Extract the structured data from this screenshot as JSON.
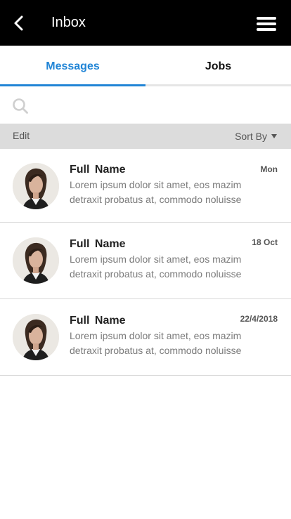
{
  "header": {
    "title": "Inbox"
  },
  "tabs": [
    {
      "label": "Messages",
      "active": true
    },
    {
      "label": "Jobs",
      "active": false
    }
  ],
  "search": {
    "placeholder": "",
    "value": ""
  },
  "toolbar": {
    "edit_label": "Edit",
    "sort_label": "Sort By"
  },
  "messages": [
    {
      "name": "Full Name",
      "date": "Mon",
      "preview": "Lorem ipsum dolor sit amet, eos mazim detraxit probatus at, commodo noluisse"
    },
    {
      "name": "Full Name",
      "date": "18 Oct",
      "preview": "Lorem ipsum dolor sit amet, eos mazim detraxit probatus at, commodo noluisse"
    },
    {
      "name": "Full Name",
      "date": "22/4/2018",
      "preview": "Lorem ipsum dolor sit amet, eos mazim detraxit probatus at, commodo noluisse"
    }
  ],
  "colors": {
    "accent": "#2185d6",
    "header_bg": "#000000",
    "toolbar_bg": "#dcdcdc"
  },
  "icons": {
    "back": "chevron-left-icon",
    "menu": "hamburger-menu-icon",
    "search": "search-icon",
    "sort": "caret-down-icon"
  }
}
